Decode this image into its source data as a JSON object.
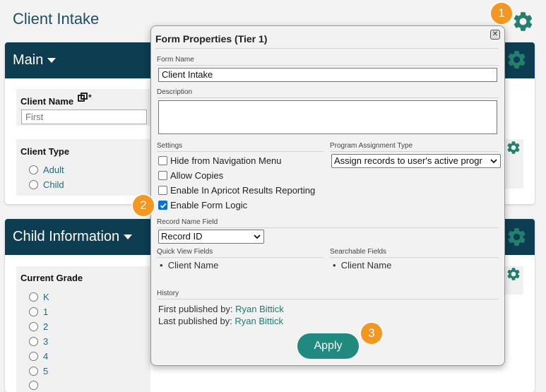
{
  "page": {
    "title": "Client Intake"
  },
  "sections": {
    "main": {
      "title": "Main",
      "client_name_label": "Client Name",
      "required_mark": "*",
      "first_placeholder": "First",
      "client_type_label": "Client Type",
      "client_type_options": [
        "Adult",
        "Child"
      ]
    },
    "child_info": {
      "title": "Child Information",
      "current_grade_label": "Current Grade",
      "grade_options": [
        "K",
        "1",
        "2",
        "3",
        "4",
        "5"
      ]
    }
  },
  "modal": {
    "title": "Form Properties (Tier 1)",
    "close_glyph": "✕",
    "form_name_label": "Form Name",
    "form_name_value": "Client Intake",
    "description_label": "Description",
    "description_value": "",
    "settings_label": "Settings",
    "settings_options": [
      {
        "label": "Hide from Navigation Menu",
        "checked": false
      },
      {
        "label": "Allow Copies",
        "checked": false
      },
      {
        "label": "Enable In Apricot Results Reporting",
        "checked": false
      },
      {
        "label": "Enable Form Logic",
        "checked": true
      }
    ],
    "program_assignment_label": "Program Assignment Type",
    "program_assignment_value": "Assign records to user's active progr",
    "record_name_label": "Record Name Field",
    "record_name_value": "Record ID",
    "quick_view_label": "Quick View Fields",
    "quick_view_fields": [
      "Client Name"
    ],
    "searchable_label": "Searchable Fields",
    "searchable_fields": [
      "Client Name"
    ],
    "history_label": "History",
    "first_published_prefix": "First published by: ",
    "first_published_by": "Ryan Bittick",
    "last_published_prefix": "Last published by: ",
    "last_published_by": "Ryan Bittick",
    "apply_label": "Apply"
  },
  "badges": [
    "1",
    "2",
    "3"
  ],
  "colors": {
    "header_navy": "#0d3d51",
    "teal": "#1f8a7d",
    "gear_teal": "#23806f",
    "badge_orange": "#f39720",
    "checkbox_blue": "#0b6fd6"
  },
  "icons": {
    "settings": "gear-icon",
    "copy": "copy-icon",
    "close": "close-icon"
  }
}
